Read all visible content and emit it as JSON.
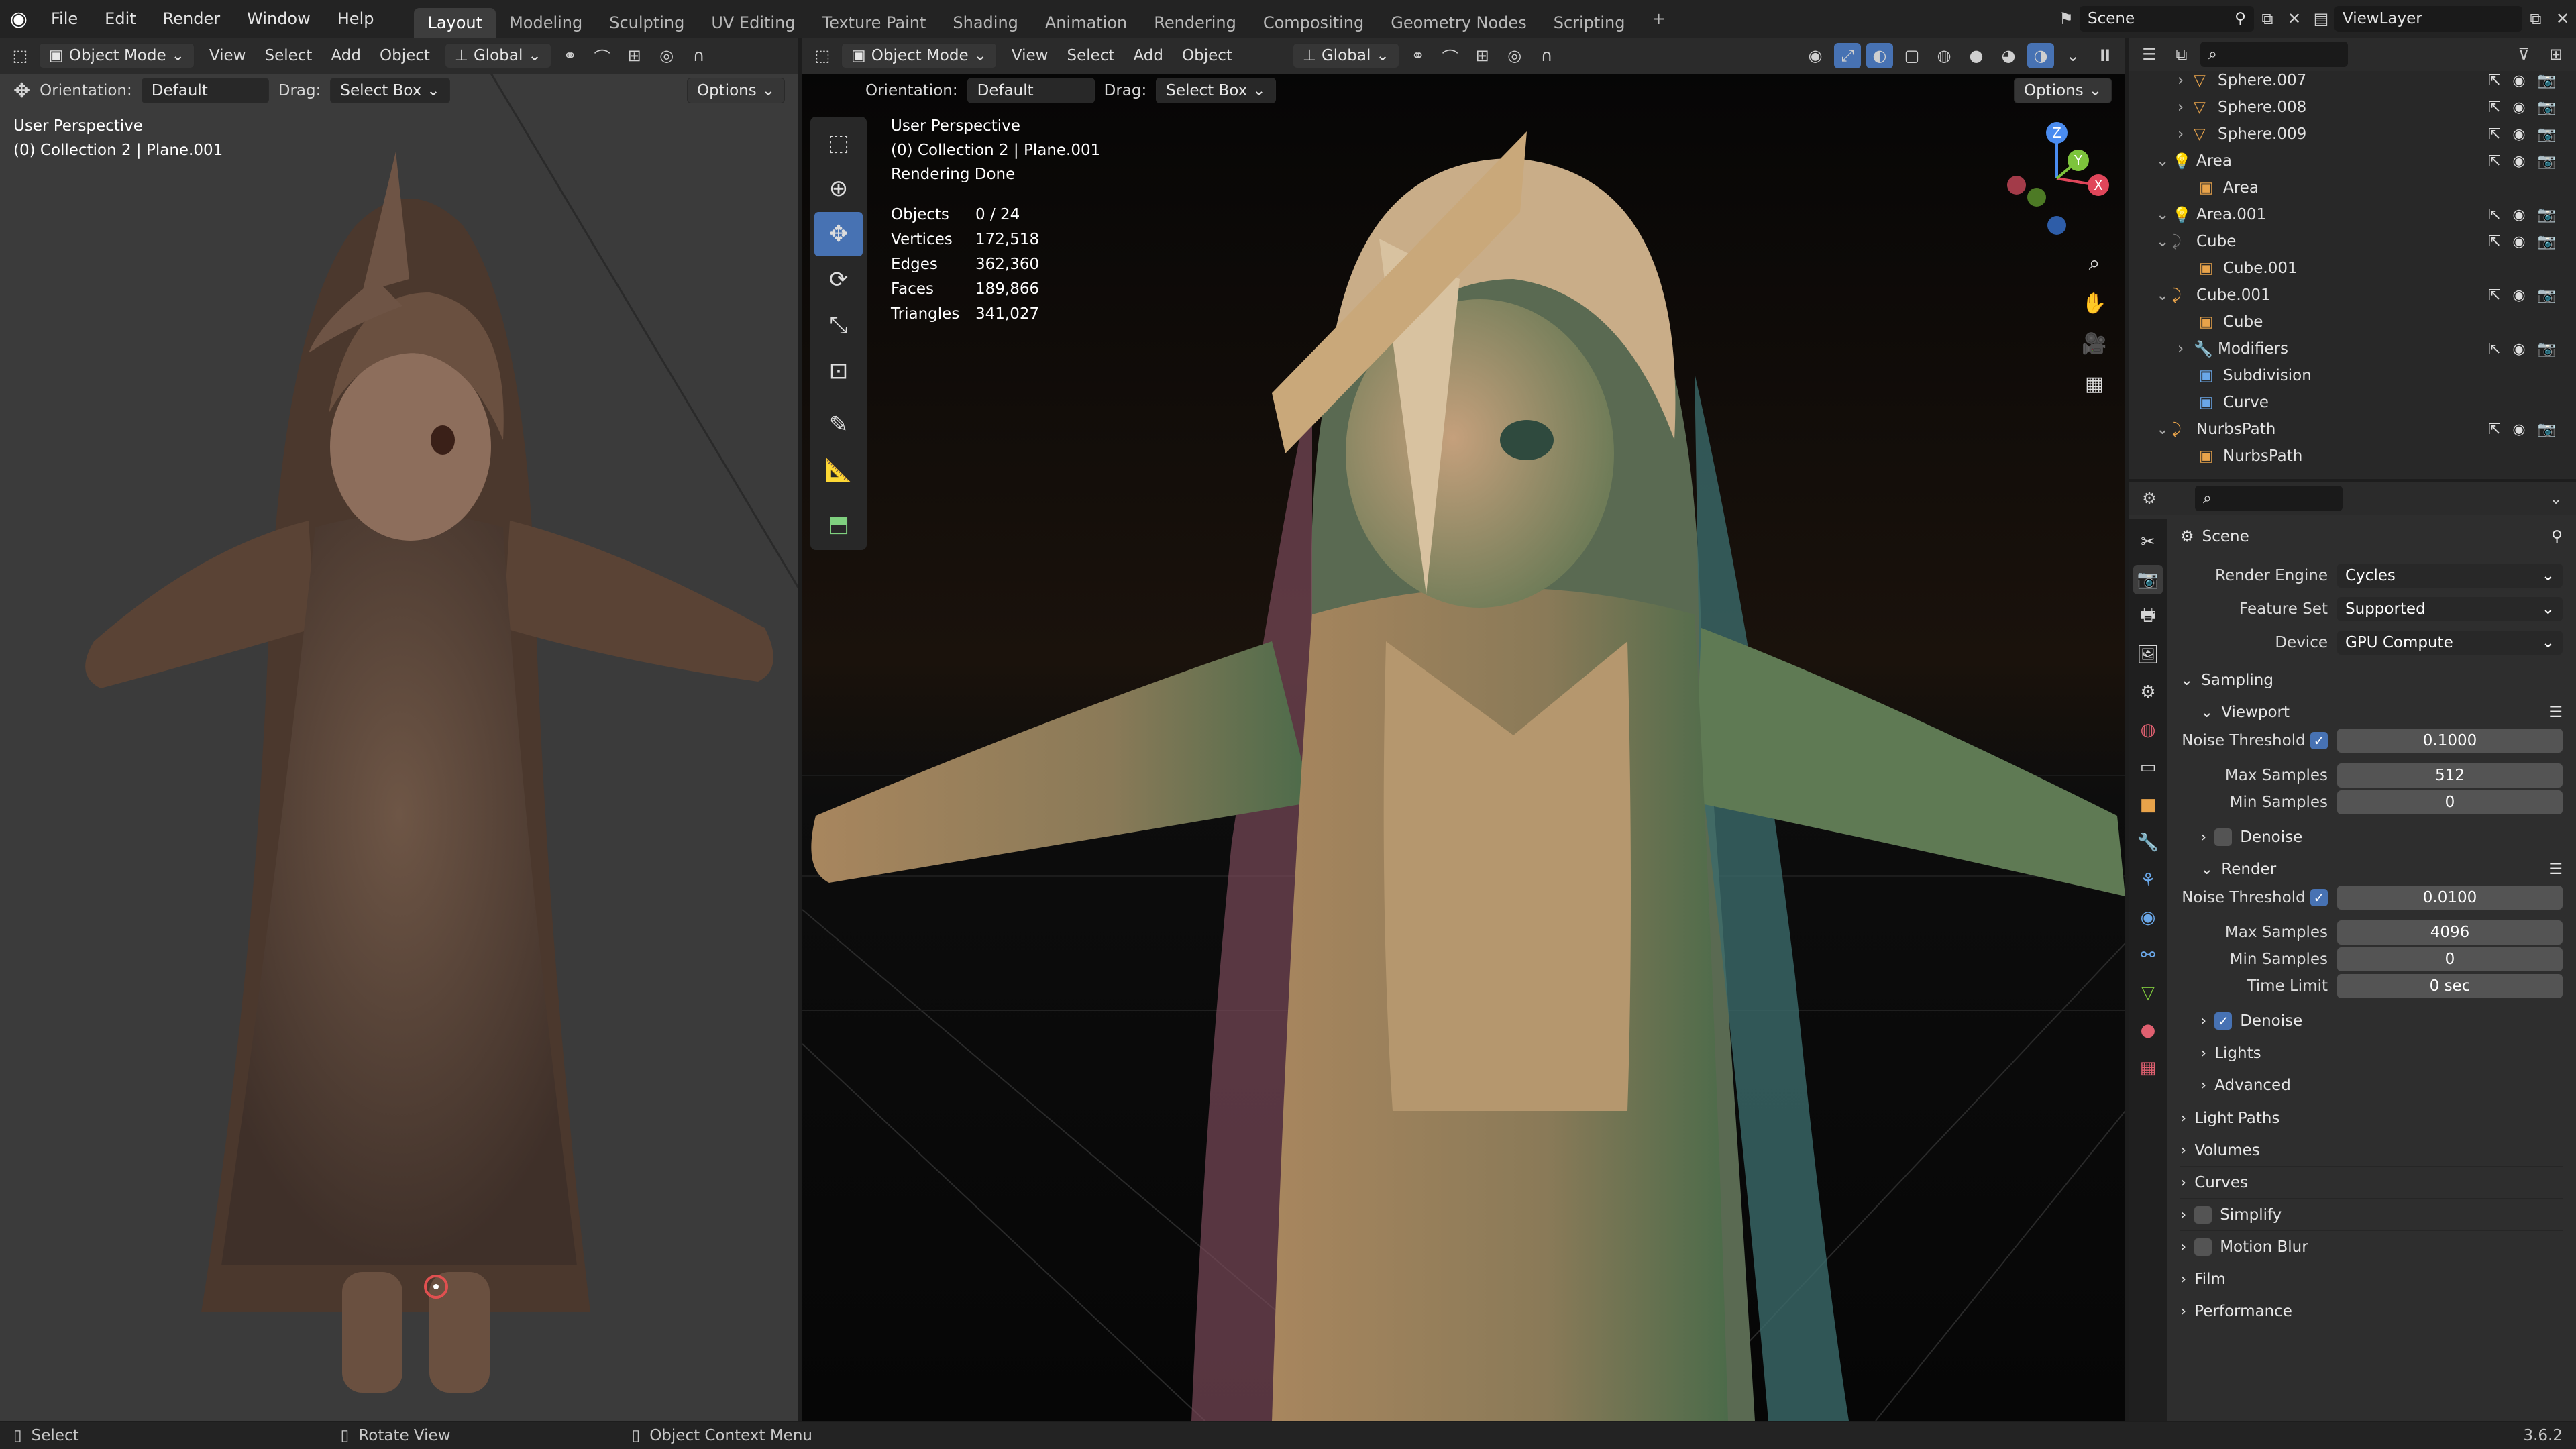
{
  "topbar": {
    "menus": [
      "File",
      "Edit",
      "Render",
      "Window",
      "Help"
    ],
    "tabs": [
      {
        "label": "Layout",
        "active": true
      },
      {
        "label": "Modeling"
      },
      {
        "label": "Sculpting"
      },
      {
        "label": "UV Editing"
      },
      {
        "label": "Texture Paint"
      },
      {
        "label": "Shading"
      },
      {
        "label": "Animation"
      },
      {
        "label": "Rendering"
      },
      {
        "label": "Compositing"
      },
      {
        "label": "Geometry Nodes"
      },
      {
        "label": "Scripting"
      }
    ],
    "add_tab": "+",
    "scene": "Scene",
    "view_layer": "ViewLayer"
  },
  "left_viewport": {
    "mode": "Object Mode",
    "menus": [
      "View",
      "Select",
      "Add",
      "Object"
    ],
    "transform": "Global",
    "orientation_label": "Orientation:",
    "orientation": "Default",
    "drag_label": "Drag:",
    "drag": "Select Box",
    "options": "Options",
    "info_line1": "User Perspective",
    "info_line2": "(0) Collection 2 | Plane.001"
  },
  "main_viewport": {
    "mode": "Object Mode",
    "menus": [
      "View",
      "Select",
      "Add",
      "Object"
    ],
    "transform": "Global",
    "orientation_label": "Orientation:",
    "orientation": "Default",
    "drag_label": "Drag:",
    "drag": "Select Box",
    "options": "Options",
    "info_line1": "User Perspective",
    "info_line2": "(0) Collection 2 | Plane.001",
    "info_line3": "Rendering Done",
    "stats": [
      {
        "k": "Objects",
        "v": "0 / 24"
      },
      {
        "k": "Vertices",
        "v": "172,518"
      },
      {
        "k": "Edges",
        "v": "362,360"
      },
      {
        "k": "Faces",
        "v": "189,866"
      },
      {
        "k": "Triangles",
        "v": "341,027"
      }
    ],
    "gizmo": {
      "z": "Z",
      "y": "Y",
      "x": "X"
    }
  },
  "outliner": {
    "rows": [
      {
        "label": "Sphere.007",
        "indent": 1,
        "icon": "mesh",
        "color": "#e8a34a"
      },
      {
        "label": "Sphere.008",
        "indent": 1,
        "icon": "mesh",
        "color": "#e8a34a"
      },
      {
        "label": "Sphere.009",
        "indent": 1,
        "icon": "mesh",
        "color": "#e8a34a"
      },
      {
        "label": "Area",
        "indent": 0,
        "icon": "light",
        "color": "#e8a34a"
      },
      {
        "label": "Area",
        "indent": 2,
        "icon": "none",
        "color": "#e8a34a"
      },
      {
        "label": "Area.001",
        "indent": 0,
        "icon": "light",
        "color": "#e8a34a"
      },
      {
        "label": "Cube",
        "indent": 0,
        "icon": "curve",
        "color": "#777"
      },
      {
        "label": "Cube.001",
        "indent": 2,
        "icon": "none",
        "color": "#e8a34a"
      },
      {
        "label": "Cube.001",
        "indent": 0,
        "icon": "curve",
        "color": "#e8a34a"
      },
      {
        "label": "Cube",
        "indent": 2,
        "icon": "none",
        "color": "#e8a34a"
      },
      {
        "label": "Modifiers",
        "indent": 1,
        "icon": "wrench",
        "color": "#6aa7e8"
      },
      {
        "label": "Subdivision",
        "indent": 2,
        "icon": "none",
        "color": "#6aa7e8"
      },
      {
        "label": "Curve",
        "indent": 2,
        "icon": "none",
        "color": "#6aa7e8"
      },
      {
        "label": "NurbsPath",
        "indent": 0,
        "icon": "curve",
        "color": "#e8a34a"
      },
      {
        "label": "NurbsPath",
        "indent": 2,
        "icon": "none",
        "color": "#e8a34a"
      }
    ]
  },
  "properties": {
    "context": "Scene",
    "render_engine_label": "Render Engine",
    "render_engine": "Cycles",
    "feature_set_label": "Feature Set",
    "feature_set": "Supported",
    "device_label": "Device",
    "device": "GPU Compute",
    "sampling": "Sampling",
    "viewport": "Viewport",
    "vp_noise_label": "Noise Threshold",
    "vp_noise": "0.1000",
    "vp_max_label": "Max Samples",
    "vp_max": "512",
    "vp_min_label": "Min Samples",
    "vp_min": "0",
    "vp_denoise": "Denoise",
    "render": "Render",
    "r_noise_label": "Noise Threshold",
    "r_noise": "0.0100",
    "r_max_label": "Max Samples",
    "r_max": "4096",
    "r_min_label": "Min Samples",
    "r_min": "0",
    "r_time_label": "Time Limit",
    "r_time": "0 sec",
    "r_denoise": "Denoise",
    "lights": "Lights",
    "advanced": "Advanced",
    "panels": [
      "Light Paths",
      "Volumes",
      "Curves",
      "Simplify",
      "Motion Blur",
      "Film",
      "Performance"
    ]
  },
  "statusbar": {
    "select": "Select",
    "rotate": "Rotate View",
    "context": "Object Context Menu",
    "version": "3.6.2"
  }
}
